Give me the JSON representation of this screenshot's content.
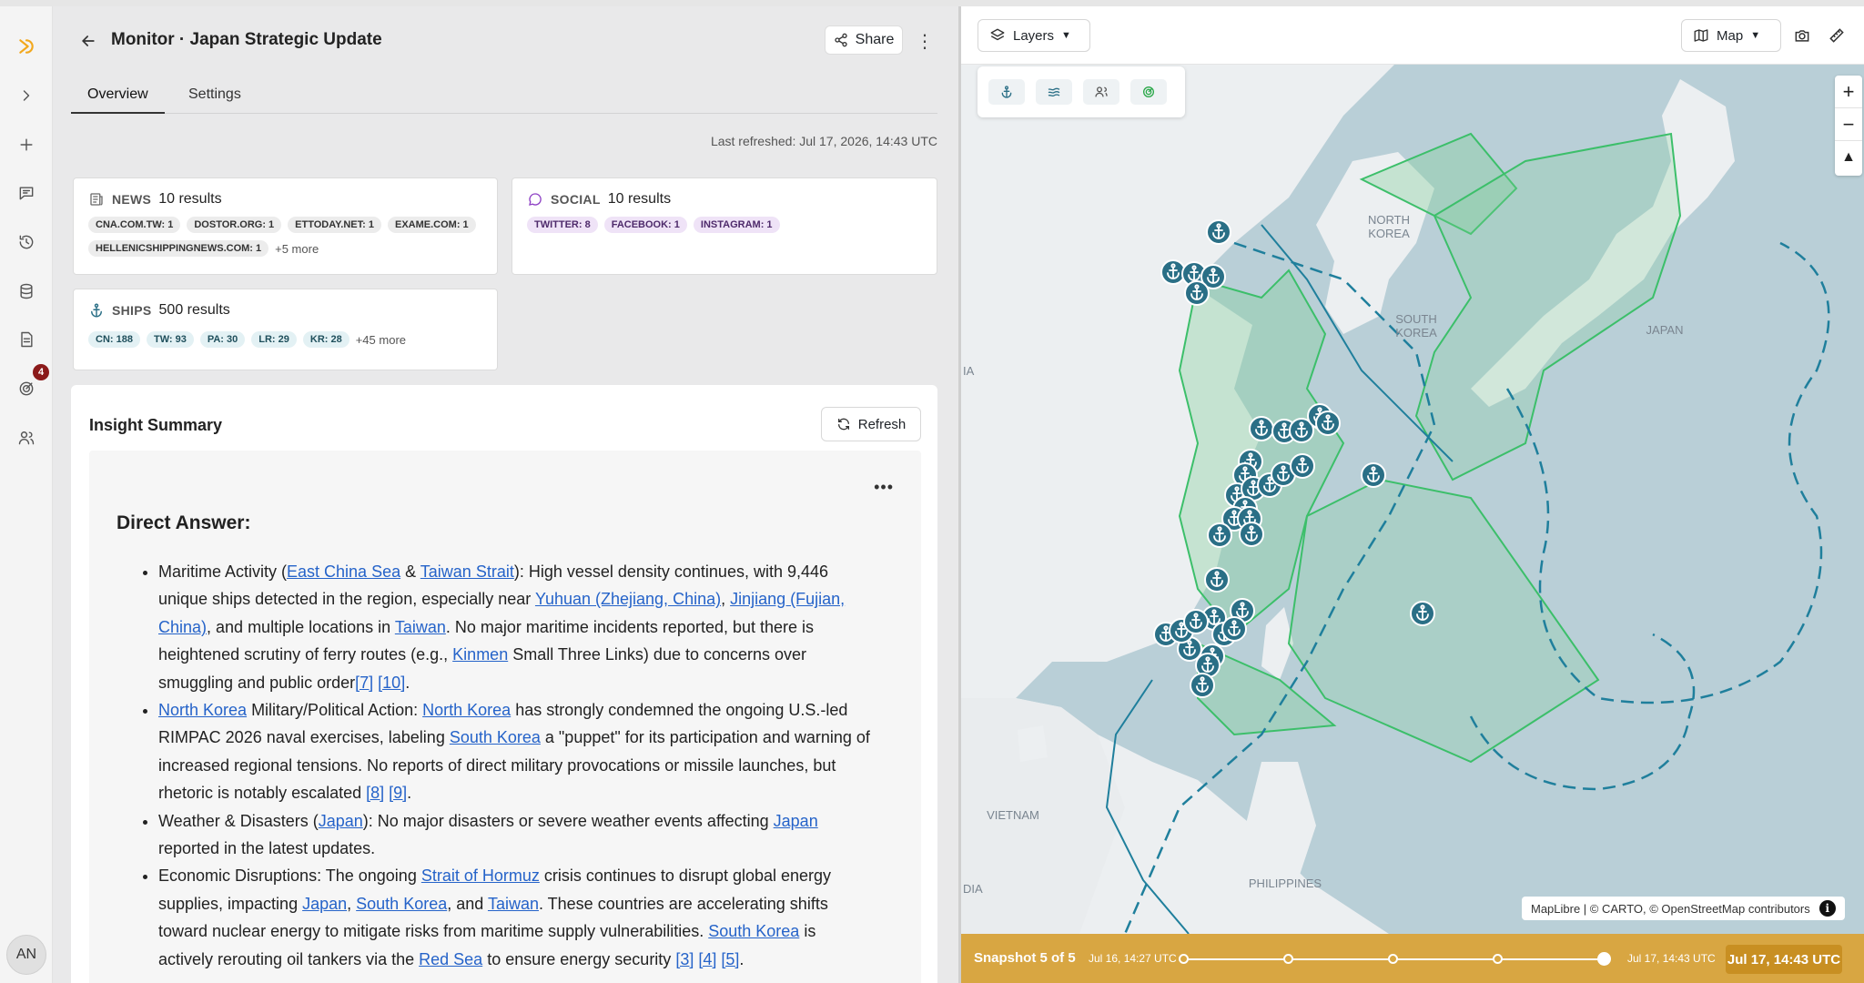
{
  "header": {
    "title": "Monitor · Japan Strategic Update",
    "share_label": "Share"
  },
  "tabs": [
    {
      "label": "Overview"
    },
    {
      "label": "Settings"
    }
  ],
  "last_refreshed": "Last refreshed: Jul 17, 2026, 14:43 UTC",
  "rail": {
    "badge_count": "4",
    "avatar_initials": "AN"
  },
  "sources": {
    "news": {
      "category": "NEWS",
      "count": "10 results",
      "chips": [
        "CNA.COM.TW: 1",
        "DOSTOR.ORG: 1",
        "ETTODAY.NET: 1",
        "EXAME.COM: 1",
        "HELLENICSHIPPINGNEWS.COM: 1"
      ],
      "more": "+5 more"
    },
    "social": {
      "category": "SOCIAL",
      "count": "10 results",
      "chips": [
        "TWITTER: 8",
        "FACEBOOK: 1",
        "INSTAGRAM: 1"
      ]
    },
    "ships": {
      "category": "SHIPS",
      "count": "500 results",
      "chips": [
        "CN: 188",
        "TW: 93",
        "PA: 30",
        "LR: 29",
        "KR: 28"
      ],
      "more": "+45 more"
    }
  },
  "insight": {
    "title": "Insight Summary",
    "refresh_label": "Refresh",
    "heading": "Direct Answer:",
    "bullets": [
      {
        "segments": [
          {
            "t": "Maritime Activity ("
          },
          {
            "t": "East China Sea",
            "link": true
          },
          {
            "t": " & "
          },
          {
            "t": "Taiwan Strait",
            "link": true
          },
          {
            "t": "): High vessel density continues, with 9,446 unique ships detected in the region, especially near "
          },
          {
            "t": "Yuhuan (Zhejiang, China)",
            "link": true
          },
          {
            "t": ", "
          },
          {
            "t": "Jinjiang (Fujian, China)",
            "link": true
          },
          {
            "t": ", and multiple locations in "
          },
          {
            "t": "Taiwan",
            "link": true
          },
          {
            "t": ". No major maritime incidents reported, but there is heightened scrutiny of ferry routes (e.g., "
          },
          {
            "t": "Kinmen",
            "link": true
          },
          {
            "t": " Small Three Links) due to concerns over smuggling and public order"
          },
          {
            "t": "[7]",
            "link": true
          },
          {
            "t": " "
          },
          {
            "t": "[10]",
            "link": true
          },
          {
            "t": "."
          }
        ]
      },
      {
        "segments": [
          {
            "t": "North Korea",
            "link": true
          },
          {
            "t": " Military/Political Action: "
          },
          {
            "t": "North Korea",
            "link": true
          },
          {
            "t": " has strongly condemned the ongoing U.S.-led RIMPAC 2026 naval exercises, labeling "
          },
          {
            "t": "South Korea",
            "link": true
          },
          {
            "t": " a \"puppet\" for its participation and warning of increased regional tensions. No reports of direct military provocations or missile launches, but rhetoric is notably escalated "
          },
          {
            "t": "[8]",
            "link": true
          },
          {
            "t": " "
          },
          {
            "t": "[9]",
            "link": true
          },
          {
            "t": "."
          }
        ]
      },
      {
        "segments": [
          {
            "t": "Weather & Disasters ("
          },
          {
            "t": "Japan",
            "link": true
          },
          {
            "t": "): No major disasters or severe weather events affecting "
          },
          {
            "t": "Japan",
            "link": true
          },
          {
            "t": " reported in the latest updates."
          }
        ]
      },
      {
        "segments": [
          {
            "t": "Economic Disruptions: The ongoing "
          },
          {
            "t": "Strait of Hormuz",
            "link": true
          },
          {
            "t": " crisis continues to disrupt global energy supplies, impacting "
          },
          {
            "t": "Japan",
            "link": true
          },
          {
            "t": ", "
          },
          {
            "t": "South Korea",
            "link": true
          },
          {
            "t": ", and "
          },
          {
            "t": "Taiwan",
            "link": true
          },
          {
            "t": ". These countries are accelerating shifts toward nuclear energy to mitigate risks from maritime supply vulnerabilities. "
          },
          {
            "t": "South Korea",
            "link": true
          },
          {
            "t": " is actively rerouting oil tankers via the "
          },
          {
            "t": "Red Sea",
            "link": true
          },
          {
            "t": " to ensure energy security "
          },
          {
            "t": "[3]",
            "link": true
          },
          {
            "t": " "
          },
          {
            "t": "[4]",
            "link": true
          },
          {
            "t": " "
          },
          {
            "t": "[5]",
            "link": true
          },
          {
            "t": "."
          }
        ]
      }
    ]
  },
  "map": {
    "layers_label": "Layers",
    "maptype_label": "Map",
    "labels": {
      "north_korea": "NORTH\nKOREA",
      "south_korea": "SOUTH\nKOREA",
      "japan": "JAPAN",
      "vietnam": "VIETNAM",
      "philippines": "PHILIPPINES",
      "edge_ia1": "IA",
      "edge_dia": "DIA"
    },
    "attribution": "MapLibre | © CARTO, © OpenStreetMap contributors",
    "timeline": {
      "label": "Snapshot 5 of 5",
      "start": "Jul 16, 14:27 UTC",
      "end": "Jul 17, 14:43 UTC",
      "current": "Jul 17, 14:43 UTC",
      "snapshot_index": 5,
      "snapshot_total": 5
    },
    "colors": {
      "sea_zone": "#b9cfd7",
      "zone_border": "#1f7f9c",
      "green_zone": "#3cbf6a",
      "pin": "#2a6f86",
      "timeline": "#d8a642"
    }
  }
}
